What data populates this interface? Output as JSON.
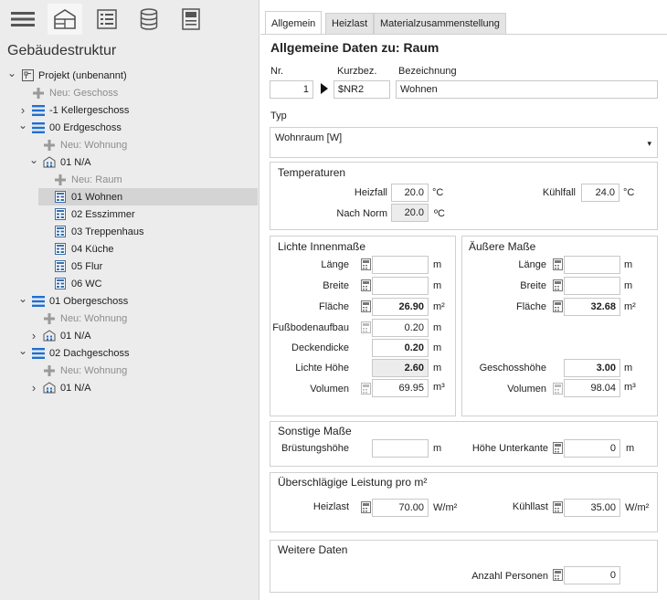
{
  "sidebar": {
    "title": "Gebäudestruktur",
    "toolbar": [
      {
        "icon": "menu-icon"
      },
      {
        "icon": "building-layout-icon"
      },
      {
        "icon": "list-icon"
      },
      {
        "icon": "database-icon"
      },
      {
        "icon": "form-icon"
      }
    ],
    "tree": [
      {
        "label": "Projekt (unbenannt)",
        "icon": "project-icon",
        "chevron": "down"
      },
      {
        "label": "Neu: Geschoss",
        "icon": "plus-icon",
        "dim": true
      },
      {
        "label": "-1 Kellergeschoss",
        "icon": "floor-icon",
        "chevron": "right"
      },
      {
        "label": "00 Erdgeschoss",
        "icon": "floor-icon",
        "chevron": "down"
      },
      {
        "label": "Neu: Wohnung",
        "icon": "plus-icon",
        "dim": true
      },
      {
        "label": "01 N/A",
        "icon": "apartment-icon",
        "chevron": "down"
      },
      {
        "label": "Neu: Raum",
        "icon": "plus-icon",
        "dim": true
      },
      {
        "label": "01 Wohnen",
        "icon": "room-icon",
        "selected": true
      },
      {
        "label": "02 Esszimmer",
        "icon": "room-icon"
      },
      {
        "label": "03 Treppenhaus",
        "icon": "room-icon"
      },
      {
        "label": "04 Küche",
        "icon": "room-icon"
      },
      {
        "label": "05 Flur",
        "icon": "room-icon"
      },
      {
        "label": "06 WC",
        "icon": "room-icon"
      },
      {
        "label": "01 Obergeschoss",
        "icon": "floor-icon",
        "chevron": "down"
      },
      {
        "label": "Neu: Wohnung",
        "icon": "plus-icon",
        "dim": true
      },
      {
        "label": "01 N/A",
        "icon": "apartment-icon",
        "chevron": "right"
      },
      {
        "label": "02 Dachgeschoss",
        "icon": "floor-icon",
        "chevron": "down"
      },
      {
        "label": "Neu: Wohnung",
        "icon": "plus-icon",
        "dim": true
      },
      {
        "label": "01 N/A",
        "icon": "apartment-icon",
        "chevron": "right"
      }
    ]
  },
  "tabs": [
    "Allgemein",
    "Heizlast",
    "Materialzusammenstellung"
  ],
  "main": {
    "heading": "Allgemeine Daten zu: Raum",
    "nr_label": "Nr.",
    "nr_value": "1",
    "kurzbez_label": "Kurzbez.",
    "kurzbez_value": "$NR2",
    "bezeichnung_label": "Bezeichnung",
    "bezeichnung_value": "Wohnen",
    "typ_label": "Typ",
    "typ_value": "Wohnraum [W]",
    "temperaturen": {
      "title": "Temperaturen",
      "heizfall_label": "Heizfall",
      "heizfall_value": "20.0",
      "heizfall_unit": "°C",
      "kuehlfall_label": "Kühlfall",
      "kuehlfall_value": "24.0",
      "kuehlfall_unit": "°C",
      "nach_norm_label": "Nach Norm",
      "nach_norm_value": "20.0",
      "nach_norm_unit": "ºC"
    },
    "lichte": {
      "title": "Lichte Innenmaße",
      "laenge_label": "Länge",
      "laenge_value": "",
      "laenge_unit": "m",
      "breite_label": "Breite",
      "breite_value": "",
      "breite_unit": "m",
      "flaeche_label": "Fläche",
      "flaeche_value": "26.90",
      "flaeche_unit": "m²",
      "fussboden_label": "Fußbodenaufbau",
      "fussboden_value": "0.20",
      "fussboden_unit": "m",
      "deckendicke_label": "Deckendicke",
      "deckendicke_value": "0.20",
      "deckendicke_unit": "m",
      "lichte_hoehe_label": "Lichte Höhe",
      "lichte_hoehe_value": "2.60",
      "lichte_hoehe_unit": "m",
      "volumen_label": "Volumen",
      "volumen_value": "69.95",
      "volumen_unit": "m³"
    },
    "aeussere": {
      "title": "Äußere Maße",
      "laenge_label": "Länge",
      "laenge_value": "",
      "laenge_unit": "m",
      "breite_label": "Breite",
      "breite_value": "",
      "breite_unit": "m",
      "flaeche_label": "Fläche",
      "flaeche_value": "32.68",
      "flaeche_unit": "m²",
      "geschosshoehe_label": "Geschosshöhe",
      "geschosshoehe_value": "3.00",
      "geschosshoehe_unit": "m",
      "volumen_label": "Volumen",
      "volumen_value": "98.04",
      "volumen_unit": "m³"
    },
    "sonstige": {
      "title": "Sonstige Maße",
      "bruestung_label": "Brüstungshöhe",
      "bruestung_value": "",
      "bruestung_unit": "m",
      "unterkante_label": "Höhe Unterkante",
      "unterkante_value": "0",
      "unterkante_unit": "m"
    },
    "leistung": {
      "title": "Überschlägige Leistung pro m²",
      "heizlast_label": "Heizlast",
      "heizlast_value": "70.00",
      "heizlast_unit": "W/m²",
      "kuehllast_label": "Kühllast",
      "kuehllast_value": "35.00",
      "kuehllast_unit": "W/m²"
    },
    "weitere": {
      "title": "Weitere Daten",
      "personen_label": "Anzahl Personen",
      "personen_value": "0"
    }
  }
}
